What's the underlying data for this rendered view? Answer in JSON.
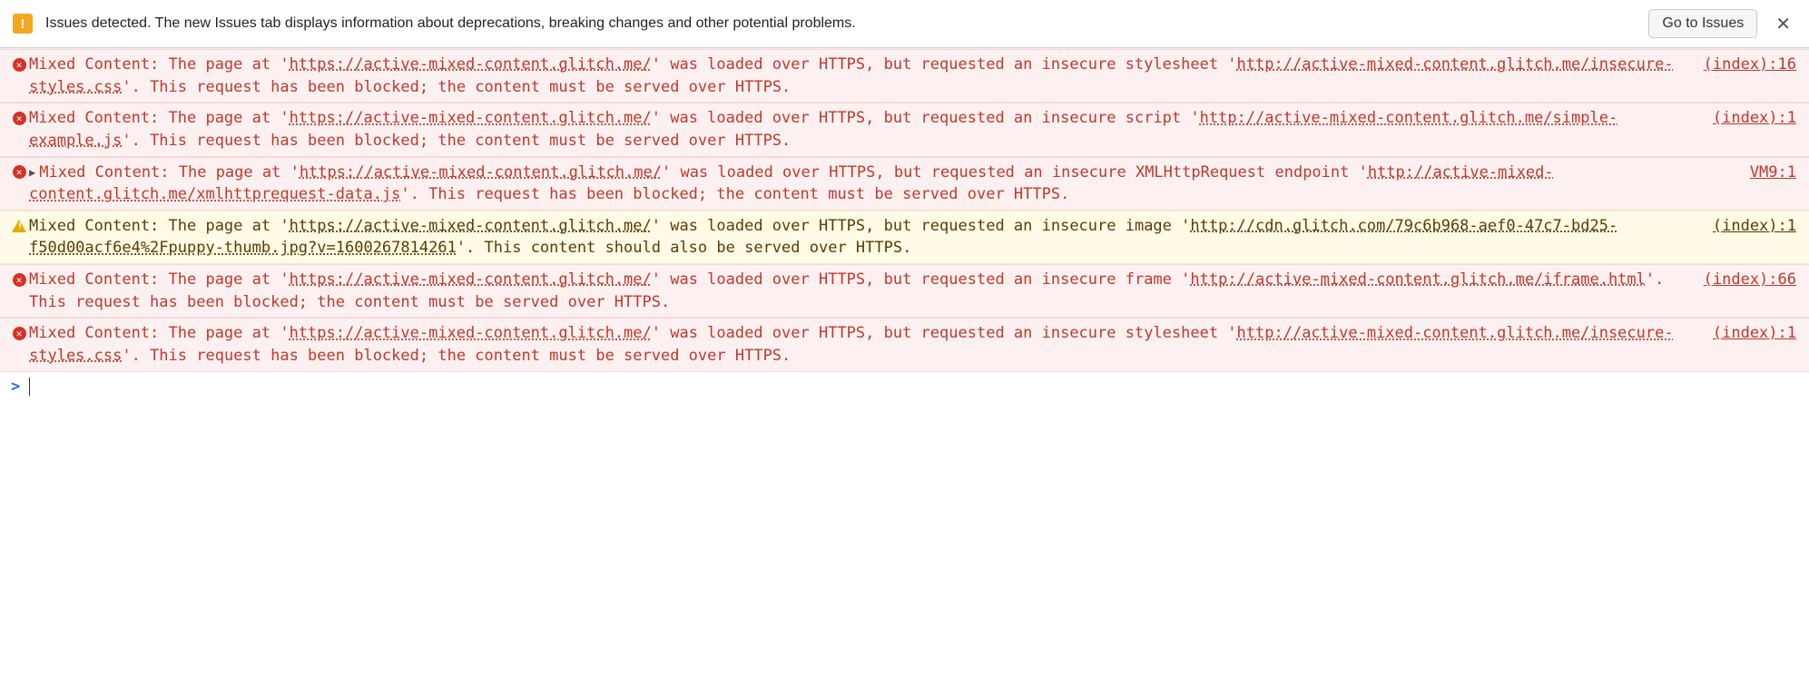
{
  "issues_bar": {
    "icon_glyph": "!",
    "text": "Issues detected. The new Issues tab displays information about deprecations, breaking changes and other potential problems.",
    "button": "Go to Issues"
  },
  "messages": [
    {
      "level": "error",
      "expandable": false,
      "source": "(index):16",
      "parts": [
        {
          "t": "Mixed Content: The page at '"
        },
        {
          "t": "https://active-mixed-content.glitch.me/",
          "ul": true
        },
        {
          "t": "' was loaded over HTTPS, but requested an insecure stylesheet '"
        },
        {
          "t": "http://active-mixed-content.glitch.me/insecure-styles.css",
          "ul": true
        },
        {
          "t": "'. This request has been blocked; the content must be served over HTTPS."
        }
      ]
    },
    {
      "level": "error",
      "expandable": false,
      "source": "(index):1",
      "parts": [
        {
          "t": "Mixed Content: The page at '"
        },
        {
          "t": "https://active-mixed-content.glitch.me/",
          "ul": true
        },
        {
          "t": "' was loaded over HTTPS, but requested an insecure script '"
        },
        {
          "t": "http://active-mixed-content.glitch.me/simple-example.js",
          "ul": true
        },
        {
          "t": "'. This request has been blocked; the content must be served over HTTPS."
        }
      ]
    },
    {
      "level": "error",
      "expandable": true,
      "source": "VM9:1",
      "parts": [
        {
          "t": "Mixed Content: The page at '"
        },
        {
          "t": "https://active-mixed-content.glitch.me/",
          "ul": true
        },
        {
          "t": "' was loaded over HTTPS, but requested an insecure XMLHttpRequest endpoint '"
        },
        {
          "t": "http://active-mixed-content.glitch.me/xmlhttprequest-data.js",
          "ul": true
        },
        {
          "t": "'. This request has been blocked; the content must be served over HTTPS."
        }
      ]
    },
    {
      "level": "warning",
      "expandable": false,
      "source": "(index):1",
      "parts": [
        {
          "t": "Mixed Content: The page at '"
        },
        {
          "t": "https://active-mixed-content.glitch.me/",
          "ul": true
        },
        {
          "t": "' was loaded over HTTPS, but requested an insecure image '"
        },
        {
          "t": "http://cdn.glitch.com/79c6b968-aef0-47c7-bd25-f50d00acf6e4%2Fpuppy-thumb.jpg?v=1600267814261",
          "ul": true
        },
        {
          "t": "'. This content should also be served over HTTPS."
        }
      ]
    },
    {
      "level": "error",
      "expandable": false,
      "source": "(index):66",
      "parts": [
        {
          "t": "Mixed Content: The page at '"
        },
        {
          "t": "https://active-mixed-content.glitch.me/",
          "ul": true
        },
        {
          "t": "' was loaded over HTTPS, but requested an insecure frame '"
        },
        {
          "t": "http://active-mixed-content.glitch.me/iframe.html",
          "ul": true
        },
        {
          "t": "'. This request has been blocked; the content must be served over HTTPS."
        }
      ]
    },
    {
      "level": "error",
      "expandable": false,
      "source": "(index):1",
      "parts": [
        {
          "t": "Mixed Content: The page at '"
        },
        {
          "t": "https://active-mixed-content.glitch.me/",
          "ul": true
        },
        {
          "t": "' was loaded over HTTPS, but requested an insecure stylesheet '"
        },
        {
          "t": "http://active-mixed-content.glitch.me/insecure-styles.css",
          "ul": true
        },
        {
          "t": "'. This request has been blocked; the content must be served over HTTPS."
        }
      ]
    }
  ],
  "prompt": {
    "caret": ">"
  }
}
